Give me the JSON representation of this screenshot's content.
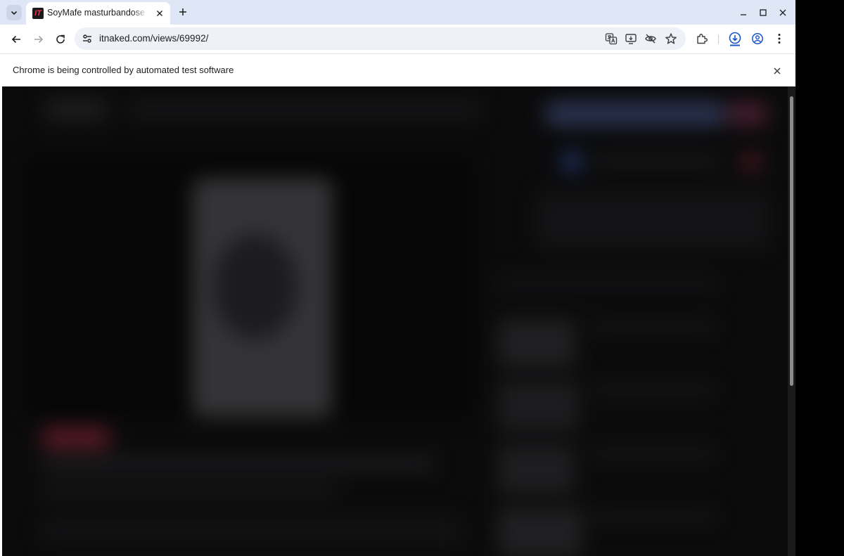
{
  "window": {
    "tab": {
      "favicon_text": "IT",
      "title": "SoyMafe masturbandose",
      "close_icon": "close-icon"
    },
    "new_tab_icon": "plus-icon",
    "controls": [
      "minimize-icon",
      "maximize-icon",
      "close-icon"
    ]
  },
  "toolbar": {
    "url": "itnaked.com/views/69992/",
    "icons": [
      "back-icon",
      "forward-icon",
      "reload-icon",
      "site-info-icon",
      "translate-icon",
      "install-app-icon",
      "eye-off-icon",
      "star-icon",
      "extensions-icon",
      "download-icon",
      "profile-icon",
      "menu-icon"
    ]
  },
  "infobar": {
    "message": "Chrome is being controlled by automated test software",
    "close_icon": "close-icon"
  },
  "colors": {
    "titlebar": "#dfe6f5",
    "omnibox": "#eef1f8",
    "page_background": "#0b0b0c",
    "accent": "#d6334d",
    "download_accent": "#1a56c9"
  }
}
